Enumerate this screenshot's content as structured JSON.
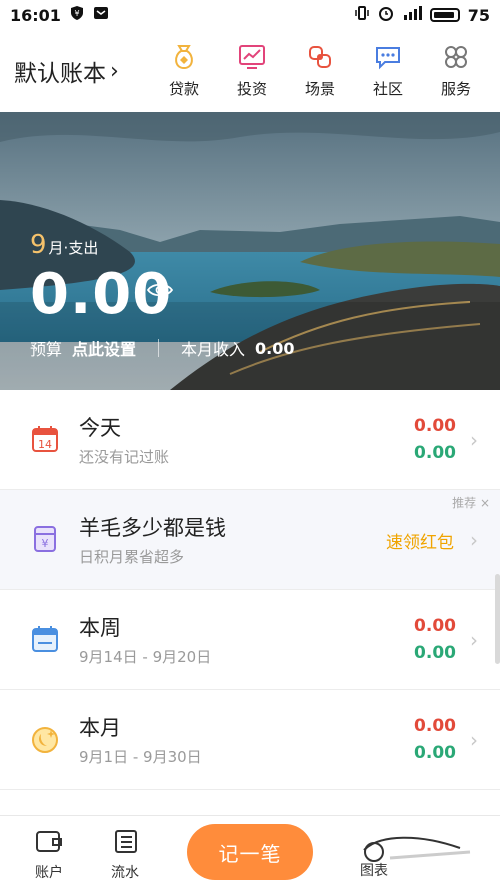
{
  "statusbar": {
    "time": "16:01",
    "battery_percent": "75",
    "icons": [
      "shield-icon",
      "message-icon",
      "vibrate-icon",
      "alarm-icon",
      "signal-icon",
      "battery-icon"
    ]
  },
  "header": {
    "book_title": "默认账本",
    "nav": [
      {
        "label": "贷款",
        "icon": "loan-bag-icon",
        "color": "#f2b33d"
      },
      {
        "label": "投资",
        "icon": "invest-chart-icon",
        "color": "#e2447a"
      },
      {
        "label": "场景",
        "icon": "scene-icon",
        "color": "#e8533f"
      },
      {
        "label": "社区",
        "icon": "community-chat-icon",
        "color": "#4a7de0"
      },
      {
        "label": "服务",
        "icon": "services-grid-icon",
        "color": "#777777"
      }
    ]
  },
  "hero": {
    "month": "9",
    "month_label": "月·支出",
    "amount": "0.00",
    "budget_label": "预算",
    "budget_action": "点此设置",
    "income_label": "本月收入",
    "income_value": "0.00"
  },
  "rows": [
    {
      "title": "今天",
      "sub": "还没有记过账",
      "v1": "0.00",
      "v2": "0.00",
      "icon": "calendar-14-icon",
      "calendar_day": "14"
    },
    {
      "title": "羊毛多少都是钱",
      "sub": "日积月累省超多",
      "action": "速领红包",
      "tag": "推荐 ×",
      "icon": "coupon-yen-icon"
    },
    {
      "title": "本周",
      "sub": "9月14日 - 9月20日",
      "v1": "0.00",
      "v2": "0.00",
      "icon": "week-calendar-icon"
    },
    {
      "title": "本月",
      "sub": "9月1日 - 9月30日",
      "v1": "0.00",
      "v2": "0.00",
      "icon": "moon-icon"
    }
  ],
  "bottom": {
    "account_label": "账户",
    "flow_label": "流水",
    "fab_label": "记一笔",
    "chart_label": "图表"
  },
  "colors": {
    "expense": "#e24a3a",
    "income": "#2aa876",
    "accent": "#ff8c3b",
    "promo": "#f0a400",
    "month_highlight": "#f5c26b"
  }
}
